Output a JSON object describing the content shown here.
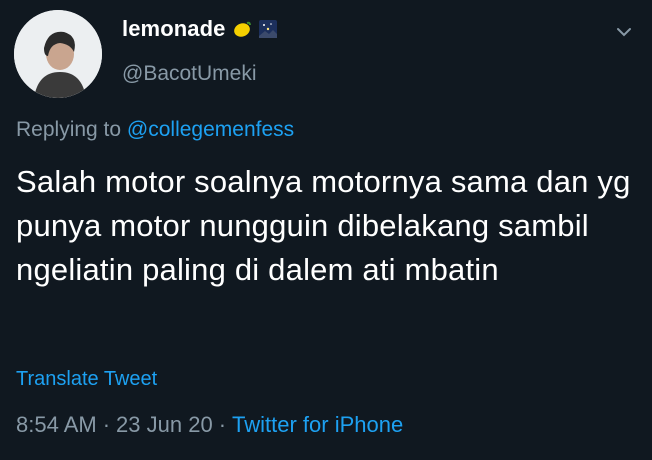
{
  "user": {
    "display_name": "lemonade",
    "handle": "@BacotUmeki",
    "emoji_1": "lemon-icon",
    "emoji_2": "night-sky-icon"
  },
  "reply": {
    "prefix": "Replying to ",
    "mention": "@collegemenfess"
  },
  "tweet": {
    "text": "Salah motor soalnya motornya sama dan yg punya motor nungguin dibelakang sambil ngeliatin paling di dalem ati mbatin"
  },
  "actions": {
    "translate_label": "Translate Tweet"
  },
  "meta": {
    "time": "8:54 AM",
    "sep1": "·",
    "date": "23 Jun 20",
    "sep2": "·",
    "source": "Twitter for iPhone"
  },
  "colors": {
    "background": "#101820",
    "accent": "#1da1f2",
    "muted": "#8899a6"
  }
}
